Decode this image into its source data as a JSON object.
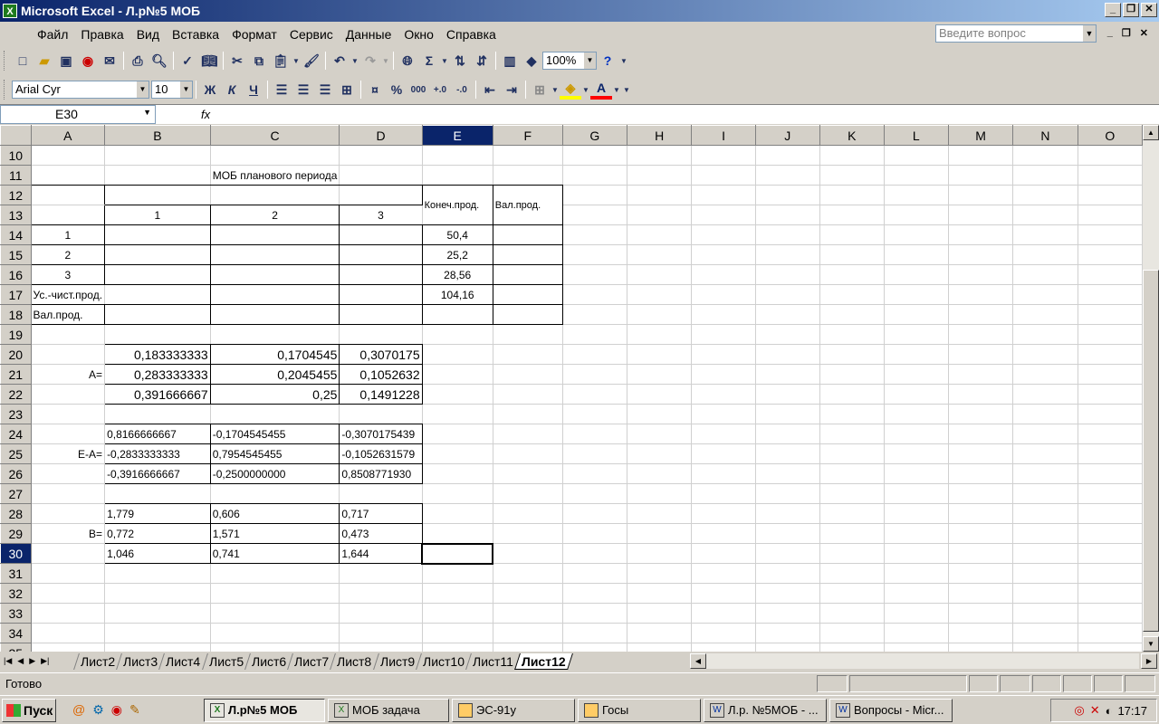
{
  "window": {
    "title": "Microsoft Excel - Л.р№5 МОБ"
  },
  "menu": [
    "Файл",
    "Правка",
    "Вид",
    "Вставка",
    "Формат",
    "Сервис",
    "Данные",
    "Окно",
    "Справка"
  ],
  "ask": {
    "placeholder": "Введите вопрос"
  },
  "toolbar": {
    "zoom": "100%",
    "font": "Arial Cyr",
    "size": "10",
    "bold": "Ж",
    "italic": "К",
    "underline": "Ч"
  },
  "formula": {
    "namebox": "E30",
    "fx": "fx"
  },
  "columns": [
    "A",
    "B",
    "C",
    "D",
    "E",
    "F",
    "G",
    "H",
    "I",
    "J",
    "K",
    "L",
    "M",
    "N",
    "O"
  ],
  "rows": [
    "10",
    "11",
    "12",
    "13",
    "14",
    "15",
    "16",
    "17",
    "18",
    "19",
    "20",
    "21",
    "22",
    "23",
    "24",
    "25",
    "26",
    "27",
    "28",
    "29",
    "30",
    "31",
    "32",
    "33",
    "34",
    "35"
  ],
  "cells": {
    "b11": "МОБ планового периода",
    "e12": "Конеч.прод.",
    "f12": "Вал.прод.",
    "b13": "1",
    "c13": "2",
    "d13": "3",
    "a14": "1",
    "e14": "50,4",
    "a15": "2",
    "e15": "25,2",
    "a16": "3",
    "e16": "28,56",
    "a17": "Ус.-чист.прод.",
    "e17": "104,16",
    "a18": "Вал.прод.",
    "b20": "0,183333333",
    "c20": "0,1704545",
    "d20": "0,3070175",
    "a21": "A=",
    "b21": "0,283333333",
    "c21": "0,2045455",
    "d21": "0,1052632",
    "b22": "0,391666667",
    "c22": "0,25",
    "d22": "0,1491228",
    "b24": "0,8166666667",
    "c24": "-0,1704545455",
    "d24": "-0,3070175439",
    "a25": "E-A=",
    "b25": "-0,2833333333",
    "c25": "0,7954545455",
    "d25": "-0,1052631579",
    "b26": "-0,3916666667",
    "c26": "-0,2500000000",
    "d26": "0,8508771930",
    "b28": "1,779",
    "c28": "0,606",
    "d28": "0,717",
    "a29": "B=",
    "b29": "0,772",
    "c29": "1,571",
    "d29": "0,473",
    "b30": "1,046",
    "c30": "0,741",
    "d30": "1,644"
  },
  "sheets": [
    "Лист2",
    "Лист3",
    "Лист4",
    "Лист5",
    "Лист6",
    "Лист7",
    "Лист8",
    "Лист9",
    "Лист10",
    "Лист11",
    "Лист12"
  ],
  "status": "Готово",
  "taskbar": {
    "start": "Пуск",
    "items": [
      "Л.р№5 МОБ",
      "МОБ задача",
      "ЭС-91у",
      "Госы",
      "Л.р. №5МОБ - ...",
      "Вопросы - Micr..."
    ],
    "clock": "17:17"
  }
}
